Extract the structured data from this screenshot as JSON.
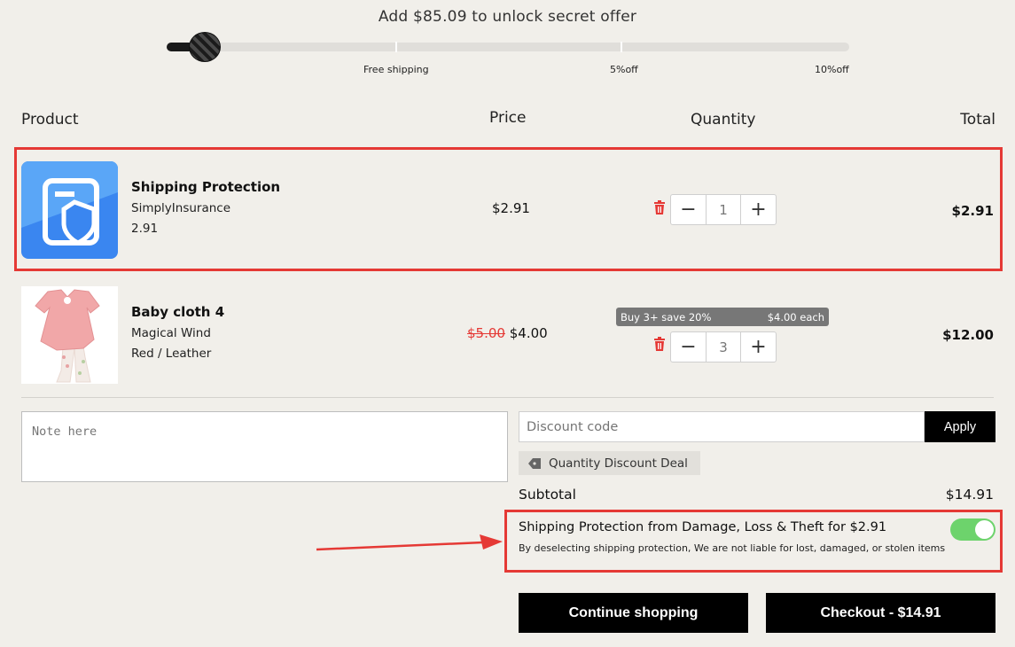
{
  "offer": {
    "message": "Add $85.09 to unlock secret offer",
    "progress": 0.05,
    "milestones": [
      "Free shipping",
      "5%off",
      "10%off"
    ]
  },
  "table": {
    "headers": {
      "product": "Product",
      "price": "Price",
      "quantity": "Quantity",
      "total": "Total"
    }
  },
  "items": [
    {
      "title": "Shipping Protection",
      "vendor": "SimplyInsurance",
      "variant": "2.91",
      "price": "$2.91",
      "compare_price": "",
      "quantity": "1",
      "total": "$2.91",
      "icon": "shield-document-icon"
    },
    {
      "title": "Baby cloth 4",
      "vendor": "Magical Wind",
      "variant": "Red / Leather",
      "price": "$4.00",
      "compare_price": "$5.00",
      "quantity": "3",
      "total": "$12.00",
      "deal_badge": {
        "left": "Buy 3+ save 20%",
        "right": "$4.00 each"
      }
    }
  ],
  "note": {
    "placeholder": "Note here"
  },
  "discount": {
    "placeholder": "Discount code",
    "apply_label": "Apply",
    "deal_label": "Quantity Discount Deal"
  },
  "summary": {
    "subtotal_label": "Subtotal",
    "subtotal_value": "$14.91"
  },
  "protection": {
    "title": "Shipping Protection from Damage, Loss & Theft for $2.91",
    "note": "By deselecting shipping protection, We are not liable for lost, damaged, or stolen items",
    "enabled": true
  },
  "buttons": {
    "continue": "Continue shopping",
    "checkout": "Checkout - $14.91"
  },
  "colors": {
    "accent_red": "#e53935",
    "toggle_green": "#6dd36c",
    "protect_blue": "#3a86f0"
  },
  "qty_controls": {
    "minus": "−",
    "plus": "+"
  }
}
